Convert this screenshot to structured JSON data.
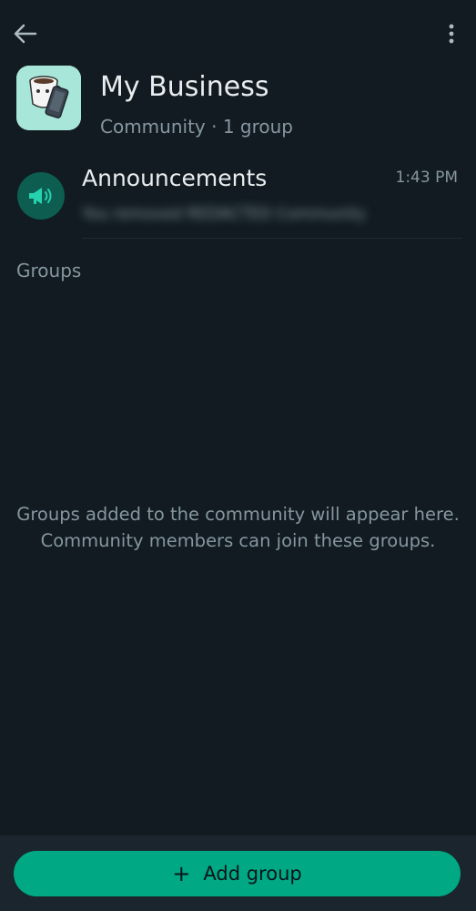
{
  "header": {
    "title": "My Business",
    "subtitle": "Community · 1 group"
  },
  "announcements": {
    "title": "Announcements",
    "time": "1:43 PM",
    "preview": "You removed REDACTED Community"
  },
  "groups": {
    "heading": "Groups",
    "empty_line1": "Groups added to the community will appear here.",
    "empty_line2": "Community members can join these groups."
  },
  "footer": {
    "add_plus": "+",
    "add_label": "Add group"
  },
  "colors": {
    "background": "#111b21",
    "accent": "#00a884",
    "secondary_text": "#8696a0"
  },
  "icons": {
    "back": "arrow-left-icon",
    "more": "more-vertical-icon",
    "announcements": "megaphone-icon",
    "add": "plus-icon"
  }
}
